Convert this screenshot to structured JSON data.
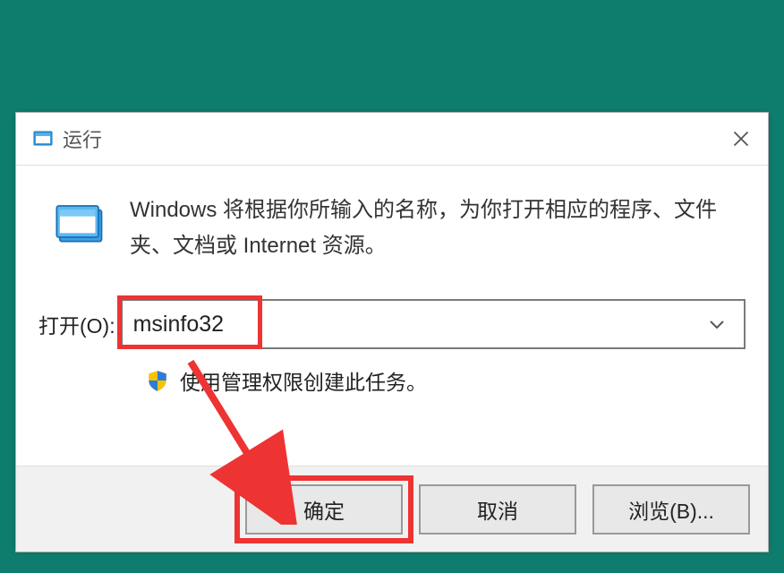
{
  "dialog": {
    "title": "运行",
    "description": "Windows 将根据你所输入的名称，为你打开相应的程序、文件夹、文档或 Internet 资源。",
    "open_label": "打开(O):",
    "input_value": "msinfo32",
    "admin_text": "使用管理权限创建此任务。",
    "buttons": {
      "ok": "确定",
      "cancel": "取消",
      "browse": "浏览(B)..."
    }
  }
}
